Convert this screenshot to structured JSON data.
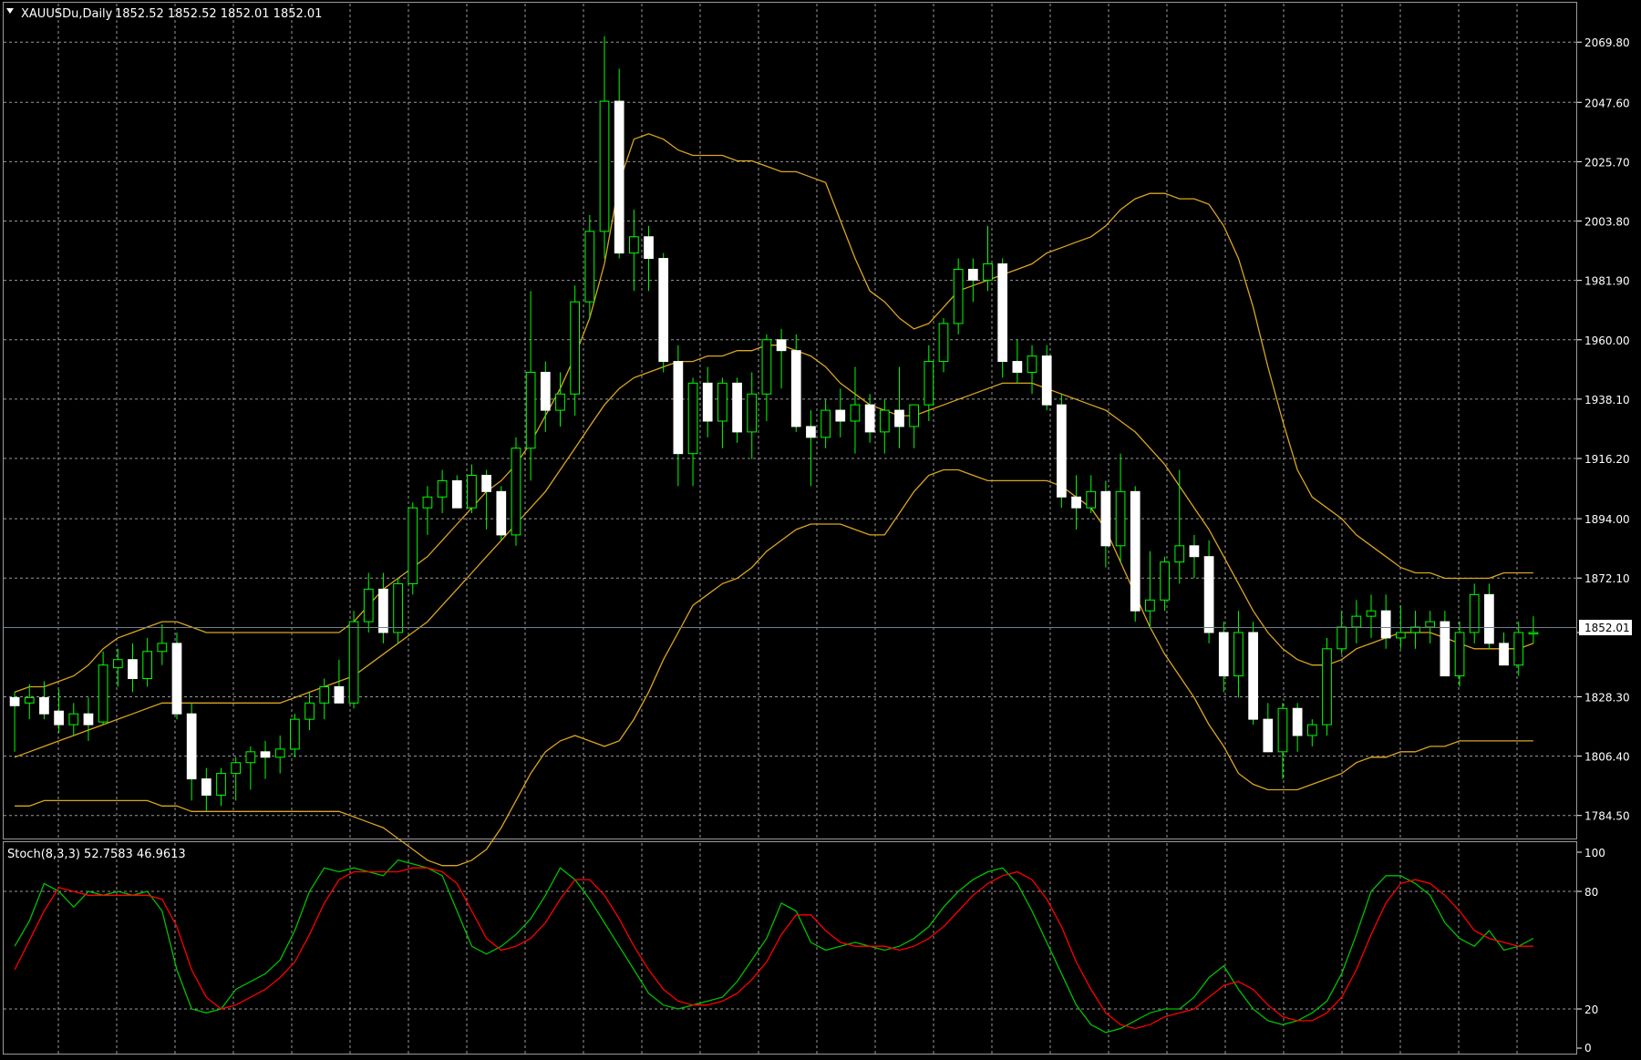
{
  "header": {
    "symbol": "XAUUSDu,Daily",
    "ohlc": "1852.52 1852.52 1852.01 1852.01",
    "menu_icon": "triangle-down-icon"
  },
  "indicator": {
    "label": "Stoch(8,3,3) 52.7583 46.9613"
  },
  "price_axis": {
    "ticks": [
      "2069.80",
      "2047.60",
      "2025.70",
      "2003.80",
      "1981.90",
      "1960.00",
      "1938.10",
      "1916.20",
      "1894.00",
      "1872.10",
      "1852.01",
      "1828.30",
      "1806.40",
      "1784.50"
    ],
    "current_price": "1852.01"
  },
  "stoch_axis": {
    "ticks": [
      "100",
      "80",
      "20",
      "0"
    ]
  },
  "colors": {
    "background": "#000000",
    "bull_candle": "#00ff00",
    "bear_candle": "#ffffff",
    "bollinger": "#daa520",
    "stoch_main": "#00c000",
    "stoch_signal": "#ff0000",
    "grid": "#c0c0c0",
    "price_line": "#708090"
  },
  "chart_data": [
    {
      "type": "candlestick",
      "title": "XAUUSDu,Daily",
      "ylim": [
        1776,
        2084
      ],
      "candles": [
        [
          1828,
          1830,
          1808,
          1825
        ],
        [
          1826,
          1833,
          1820,
          1828
        ],
        [
          1828,
          1834,
          1820,
          1822
        ],
        [
          1823,
          1831,
          1815,
          1818
        ],
        [
          1818,
          1826,
          1814,
          1822
        ],
        [
          1822,
          1828,
          1812,
          1818
        ],
        [
          1819,
          1845,
          1818,
          1840
        ],
        [
          1839,
          1846,
          1832,
          1842
        ],
        [
          1842,
          1848,
          1830,
          1835
        ],
        [
          1835,
          1850,
          1832,
          1845
        ],
        [
          1845,
          1855,
          1840,
          1848
        ],
        [
          1848,
          1852,
          1820,
          1822
        ],
        [
          1822,
          1826,
          1790,
          1798
        ],
        [
          1798,
          1802,
          1786,
          1792
        ],
        [
          1792,
          1802,
          1788,
          1800
        ],
        [
          1800,
          1806,
          1790,
          1804
        ],
        [
          1804,
          1810,
          1794,
          1808
        ],
        [
          1808,
          1812,
          1798,
          1806
        ],
        [
          1806,
          1814,
          1800,
          1809
        ],
        [
          1809,
          1822,
          1806,
          1820
        ],
        [
          1820,
          1830,
          1816,
          1826
        ],
        [
          1826,
          1835,
          1820,
          1832
        ],
        [
          1832,
          1842,
          1826,
          1826
        ],
        [
          1826,
          1860,
          1824,
          1856
        ],
        [
          1856,
          1874,
          1852,
          1868
        ],
        [
          1868,
          1874,
          1848,
          1852
        ],
        [
          1852,
          1872,
          1848,
          1870
        ],
        [
          1870,
          1900,
          1866,
          1898
        ],
        [
          1898,
          1906,
          1888,
          1902
        ],
        [
          1902,
          1912,
          1896,
          1908
        ],
        [
          1908,
          1910,
          1898,
          1898
        ],
        [
          1898,
          1914,
          1896,
          1910
        ],
        [
          1910,
          1912,
          1890,
          1904
        ],
        [
          1904,
          1906,
          1886,
          1888
        ],
        [
          1888,
          1924,
          1884,
          1920
        ],
        [
          1920,
          1978,
          1908,
          1948
        ],
        [
          1948,
          1952,
          1926,
          1934
        ],
        [
          1934,
          1948,
          1928,
          1940
        ],
        [
          1940,
          1980,
          1932,
          1974
        ],
        [
          1974,
          2006,
          1968,
          2000
        ],
        [
          2000,
          2072,
          1990,
          2048
        ],
        [
          2048,
          2060,
          1990,
          1992
        ],
        [
          1992,
          2008,
          1978,
          1998
        ],
        [
          1998,
          2002,
          1978,
          1990
        ],
        [
          1990,
          1992,
          1948,
          1952
        ],
        [
          1952,
          1958,
          1906,
          1918
        ],
        [
          1918,
          1946,
          1906,
          1944
        ],
        [
          1944,
          1950,
          1924,
          1930
        ],
        [
          1930,
          1946,
          1920,
          1944
        ],
        [
          1944,
          1946,
          1922,
          1926
        ],
        [
          1926,
          1948,
          1916,
          1940
        ],
        [
          1940,
          1962,
          1930,
          1960
        ],
        [
          1960,
          1964,
          1942,
          1956
        ],
        [
          1956,
          1962,
          1926,
          1928
        ],
        [
          1928,
          1934,
          1906,
          1924
        ],
        [
          1924,
          1938,
          1920,
          1934
        ],
        [
          1934,
          1942,
          1924,
          1930
        ],
        [
          1930,
          1950,
          1918,
          1936
        ],
        [
          1936,
          1940,
          1922,
          1926
        ],
        [
          1926,
          1938,
          1918,
          1934
        ],
        [
          1934,
          1950,
          1920,
          1928
        ],
        [
          1928,
          1936,
          1920,
          1936
        ],
        [
          1936,
          1958,
          1930,
          1952
        ],
        [
          1952,
          1968,
          1948,
          1966
        ],
        [
          1966,
          1990,
          1962,
          1986
        ],
        [
          1986,
          1990,
          1974,
          1982
        ],
        [
          1982,
          2002,
          1978,
          1988
        ],
        [
          1988,
          1990,
          1946,
          1952
        ],
        [
          1952,
          1960,
          1944,
          1948
        ],
        [
          1948,
          1958,
          1940,
          1954
        ],
        [
          1954,
          1958,
          1934,
          1936
        ],
        [
          1936,
          1940,
          1898,
          1902
        ],
        [
          1902,
          1910,
          1890,
          1898
        ],
        [
          1898,
          1910,
          1896,
          1904
        ],
        [
          1904,
          1908,
          1876,
          1884
        ],
        [
          1884,
          1918,
          1878,
          1904
        ],
        [
          1904,
          1906,
          1856,
          1860
        ],
        [
          1860,
          1882,
          1854,
          1864
        ],
        [
          1864,
          1880,
          1860,
          1878
        ],
        [
          1878,
          1912,
          1870,
          1884
        ],
        [
          1884,
          1888,
          1872,
          1880
        ],
        [
          1880,
          1886,
          1848,
          1852
        ],
        [
          1852,
          1856,
          1830,
          1836
        ],
        [
          1836,
          1860,
          1828,
          1852
        ],
        [
          1852,
          1856,
          1818,
          1820
        ],
        [
          1820,
          1826,
          1808,
          1808
        ],
        [
          1808,
          1826,
          1798,
          1824
        ],
        [
          1824,
          1826,
          1808,
          1814
        ],
        [
          1814,
          1820,
          1810,
          1818
        ],
        [
          1818,
          1850,
          1814,
          1846
        ],
        [
          1846,
          1860,
          1844,
          1854
        ],
        [
          1854,
          1864,
          1848,
          1858
        ],
        [
          1858,
          1866,
          1850,
          1860
        ],
        [
          1860,
          1866,
          1846,
          1850
        ],
        [
          1850,
          1862,
          1846,
          1852
        ],
        [
          1852,
          1860,
          1846,
          1854
        ],
        [
          1854,
          1860,
          1848,
          1856
        ],
        [
          1856,
          1860,
          1836,
          1836
        ],
        [
          1836,
          1856,
          1832,
          1852
        ],
        [
          1852,
          1870,
          1848,
          1866
        ],
        [
          1866,
          1870,
          1846,
          1848
        ],
        [
          1848,
          1852,
          1840,
          1840
        ],
        [
          1840,
          1856,
          1836,
          1852
        ],
        [
          1852,
          1858,
          1848,
          1852
        ]
      ],
      "bollinger": {
        "upper": [
          1830,
          1832,
          1832,
          1834,
          1836,
          1840,
          1846,
          1850,
          1852,
          1854,
          1856,
          1856,
          1854,
          1852,
          1852,
          1852,
          1852,
          1852,
          1852,
          1852,
          1852,
          1852,
          1852,
          1856,
          1862,
          1868,
          1872,
          1876,
          1880,
          1886,
          1892,
          1898,
          1904,
          1908,
          1914,
          1922,
          1932,
          1942,
          1954,
          1968,
          1988,
          2018,
          2034,
          2036,
          2034,
          2030,
          2028,
          2028,
          2028,
          2026,
          2026,
          2024,
          2022,
          2022,
          2020,
          2018,
          2004,
          1990,
          1978,
          1974,
          1968,
          1964,
          1966,
          1972,
          1978,
          1980,
          1982,
          1984,
          1986,
          1988,
          1992,
          1994,
          1996,
          1998,
          2002,
          2008,
          2012,
          2014,
          2014,
          2012,
          2012,
          2010,
          2002,
          1990,
          1972,
          1950,
          1930,
          1912,
          1902,
          1898,
          1894,
          1888,
          1884,
          1880,
          1876,
          1874,
          1874,
          1872,
          1872,
          1872,
          1872,
          1874,
          1874,
          1874
        ],
        "middle": [
          1806,
          1808,
          1810,
          1812,
          1814,
          1816,
          1818,
          1820,
          1822,
          1824,
          1826,
          1826,
          1826,
          1826,
          1826,
          1826,
          1826,
          1826,
          1826,
          1828,
          1830,
          1832,
          1834,
          1836,
          1840,
          1844,
          1848,
          1852,
          1856,
          1862,
          1868,
          1874,
          1880,
          1886,
          1892,
          1898,
          1904,
          1912,
          1920,
          1928,
          1936,
          1942,
          1946,
          1948,
          1950,
          1952,
          1952,
          1954,
          1954,
          1956,
          1956,
          1958,
          1958,
          1956,
          1954,
          1950,
          1944,
          1940,
          1936,
          1934,
          1932,
          1932,
          1934,
          1936,
          1938,
          1940,
          1942,
          1944,
          1944,
          1944,
          1942,
          1940,
          1938,
          1936,
          1934,
          1930,
          1926,
          1920,
          1914,
          1906,
          1898,
          1890,
          1880,
          1870,
          1860,
          1852,
          1846,
          1842,
          1840,
          1840,
          1842,
          1846,
          1848,
          1850,
          1852,
          1852,
          1852,
          1850,
          1848,
          1846,
          1846,
          1846,
          1846,
          1848
        ],
        "lower": [
          1788,
          1788,
          1790,
          1790,
          1790,
          1790,
          1790,
          1790,
          1790,
          1790,
          1788,
          1788,
          1786,
          1786,
          1786,
          1786,
          1786,
          1786,
          1786,
          1786,
          1786,
          1786,
          1786,
          1784,
          1782,
          1780,
          1776,
          1772,
          1768,
          1766,
          1766,
          1768,
          1772,
          1780,
          1790,
          1800,
          1808,
          1812,
          1814,
          1812,
          1810,
          1812,
          1820,
          1830,
          1842,
          1852,
          1862,
          1866,
          1870,
          1872,
          1876,
          1882,
          1886,
          1890,
          1892,
          1892,
          1892,
          1890,
          1888,
          1888,
          1896,
          1904,
          1910,
          1912,
          1912,
          1910,
          1908,
          1908,
          1908,
          1908,
          1908,
          1906,
          1902,
          1898,
          1890,
          1878,
          1866,
          1854,
          1844,
          1836,
          1828,
          1818,
          1810,
          1800,
          1796,
          1794,
          1794,
          1794,
          1796,
          1798,
          1800,
          1804,
          1806,
          1806,
          1808,
          1808,
          1810,
          1810,
          1812,
          1812,
          1812,
          1812,
          1812,
          1812
        ]
      }
    },
    {
      "type": "line",
      "title": "Stoch(8,3,3) 52.7583 46.9613",
      "ylim": [
        0,
        100
      ],
      "series": [
        {
          "values": [
            52,
            65,
            84,
            80,
            72,
            80,
            78,
            80,
            78,
            80,
            70,
            40,
            20,
            18,
            20,
            30,
            34,
            38,
            45,
            60,
            80,
            92,
            90,
            92,
            90,
            88,
            96,
            94,
            92,
            88,
            70,
            52,
            48,
            52,
            58,
            66,
            78,
            92,
            86,
            76,
            64,
            52,
            40,
            28,
            22,
            20,
            22,
            24,
            26,
            34,
            45,
            56,
            74,
            70,
            54,
            50,
            52,
            54,
            52,
            50,
            52,
            56,
            62,
            72,
            80,
            86,
            90,
            92,
            84,
            70,
            54,
            38,
            22,
            12,
            8,
            10,
            14,
            18,
            20,
            20,
            26,
            36,
            42,
            30,
            20,
            14,
            12,
            14,
            18,
            24,
            38,
            58,
            80,
            88,
            88,
            84,
            78,
            64,
            56,
            52,
            60,
            50,
            52,
            56
          ]
        },
        {
          "values": [
            40,
            55,
            70,
            82,
            80,
            78,
            78,
            78,
            78,
            78,
            76,
            62,
            40,
            26,
            20,
            22,
            26,
            30,
            36,
            44,
            58,
            74,
            86,
            90,
            90,
            90,
            90,
            92,
            92,
            90,
            84,
            70,
            56,
            50,
            52,
            56,
            64,
            76,
            86,
            86,
            78,
            66,
            52,
            40,
            30,
            24,
            22,
            22,
            24,
            28,
            35,
            44,
            58,
            68,
            68,
            60,
            54,
            52,
            52,
            52,
            50,
            52,
            56,
            62,
            70,
            78,
            84,
            88,
            90,
            86,
            76,
            62,
            44,
            30,
            18,
            12,
            10,
            12,
            16,
            18,
            20,
            26,
            32,
            34,
            30,
            22,
            16,
            14,
            14,
            18,
            26,
            40,
            58,
            74,
            84,
            86,
            84,
            78,
            70,
            60,
            56,
            54,
            52,
            52
          ]
        }
      ],
      "levels": [
        20,
        80
      ]
    }
  ]
}
